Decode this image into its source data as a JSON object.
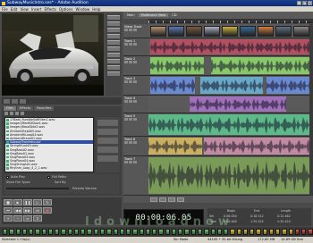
{
  "window": {
    "title": "SubwayMusicIntro.ses* - Adobe Audition",
    "controls": [
      "_",
      "□",
      "×"
    ]
  },
  "menu": [
    "File",
    "Edit",
    "View",
    "Insert",
    "Effects",
    "Options",
    "Window",
    "Help"
  ],
  "right_tabs": [
    "Main",
    "Multitrack View",
    "CD"
  ],
  "files": {
    "tabs": [
      "Files",
      "Effects",
      "Favorites"
    ],
    "items": [
      "17Beat_RumbleSoftFilter2.wav",
      "ImageryMedKitSlow1.wav",
      "ImageryBassSlide2.wav",
      "ZmDarkStep005.wav",
      "AmbientHiLoop04.wav",
      "AmbientDrone01.wav",
      "SubwayTrainIntro.avi",
      "StringHiLow03.wav",
      "SingBass02.wav",
      "SingBass01.wav",
      "SingPiano03.wav",
      "SingPiano04.wav",
      "SingStrings01.wav",
      "Rhythm_Loop_4_2_1.wav"
    ],
    "selected": 6,
    "options": {
      "auto_play": "Auto Play",
      "full_paths": "Full Paths",
      "show_file_types": "Show File Types",
      "sort_by": "Sort By:",
      "preview_volume": "Preview Volume"
    }
  },
  "tracks": [
    {
      "name": "Video Track",
      "type": "video"
    },
    {
      "name": "Track 1"
    },
    {
      "name": "Track 2"
    },
    {
      "name": "Track 3"
    },
    {
      "name": "Track 4"
    },
    {
      "name": "Track 5"
    },
    {
      "name": "Track 6"
    },
    {
      "name": "Track 7"
    }
  ],
  "clip_colors": [
    "#b05060",
    "#88c86a",
    "#6a8ad0",
    "#a070b8",
    "#5db88a",
    "#c8b060",
    "#c08aa0",
    "#7a9a58",
    "#6aa8c8"
  ],
  "timecode": "00:00:06.05",
  "selection": {
    "labels": [
      "Begin",
      "End",
      "Length"
    ],
    "sel_label": "Sel",
    "view_label": "View",
    "sel": [
      "0:06.050",
      "0:18.512",
      "0:12.462"
    ],
    "view": [
      "0:00.000",
      "1:35.424",
      "1:35.424"
    ]
  },
  "watermark": "Idownloadnow",
  "status": {
    "left": "Selected 1 Clip(s)",
    "rate": "44100 • 32-bit Mixing",
    "format": "Sin Mode",
    "mem": "172.89 MB",
    "disk": "14.69 GB free"
  }
}
